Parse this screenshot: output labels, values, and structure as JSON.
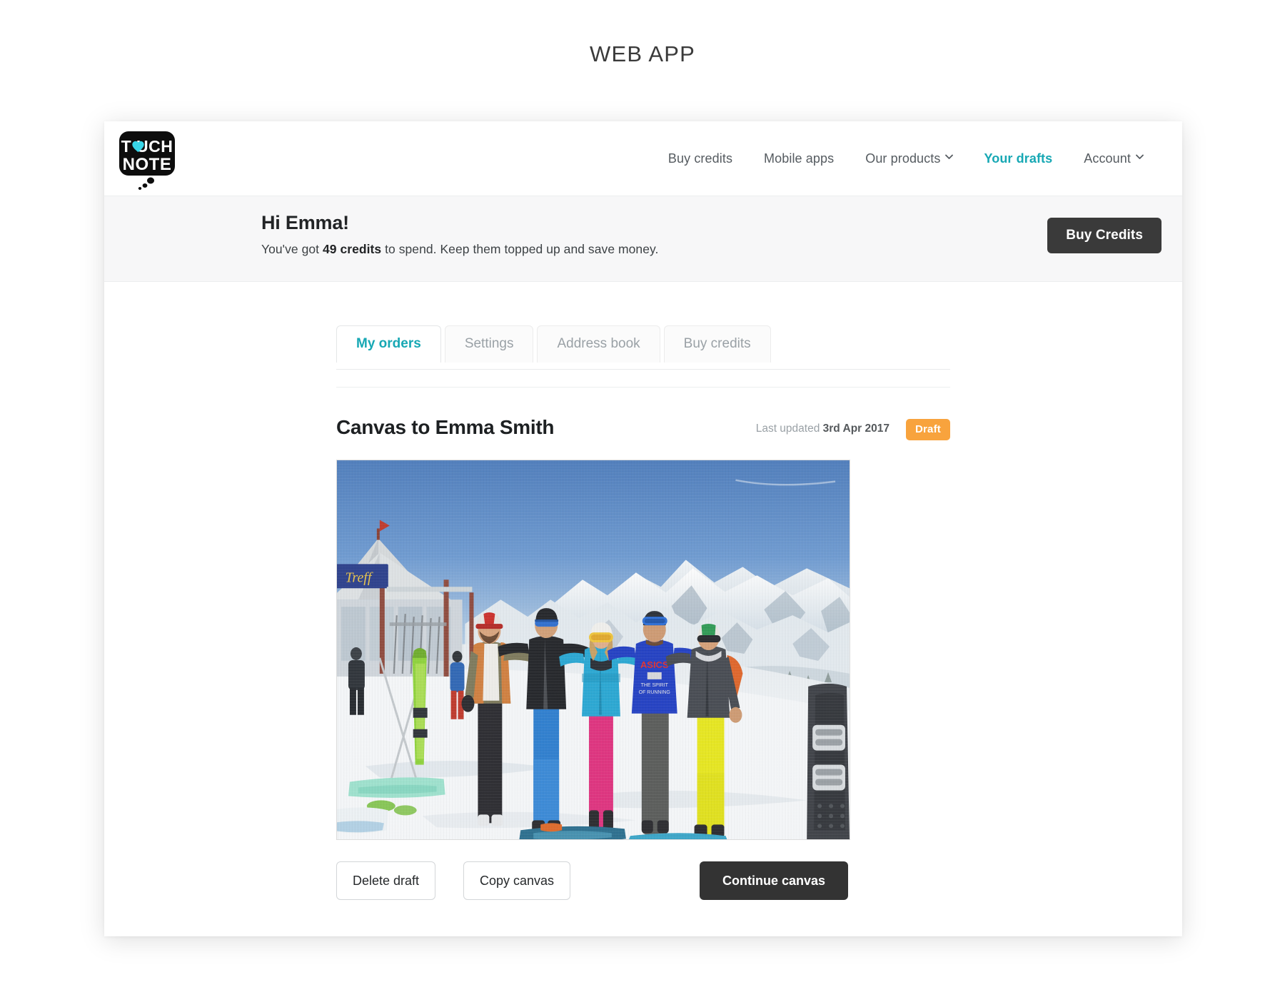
{
  "page": {
    "caption": "WEB APP"
  },
  "header": {
    "logo": {
      "name": "touchnote-logo",
      "line1": "T",
      "heart": "♥",
      "line1b": "UCH",
      "line2": "NOTE"
    },
    "nav": [
      {
        "label": "Buy credits",
        "active": false,
        "caret": false
      },
      {
        "label": "Mobile apps",
        "active": false,
        "caret": false
      },
      {
        "label": "Our products",
        "active": false,
        "caret": true
      },
      {
        "label": "Your drafts",
        "active": true,
        "caret": false
      },
      {
        "label": "Account",
        "active": false,
        "caret": true
      }
    ]
  },
  "greeting": {
    "title": "Hi Emma!",
    "sub_before": "You've got ",
    "sub_bold": "49 credits",
    "sub_after": " to spend. Keep them topped up and save money.",
    "buy_credits_label": "Buy Credits"
  },
  "tabs": [
    {
      "label": "My orders",
      "active": true
    },
    {
      "label": "Settings",
      "active": false
    },
    {
      "label": "Address book",
      "active": false
    },
    {
      "label": "Buy credits",
      "active": false
    }
  ],
  "order": {
    "title": "Canvas to Emma Smith",
    "meta_label": "Last updated ",
    "meta_date": "3rd Apr 2017",
    "status_badge": "Draft",
    "photo": {
      "name": "ski-group-photo",
      "alt": "Five friends standing together on a snowy mountain top at a ski resort, with snow covered peaks and blue sky behind them, skis and snowboards in the snow and a resort hut with a blue sign on the left"
    },
    "actions": {
      "delete_label": "Delete draft",
      "copy_label": "Copy canvas",
      "continue_label": "Continue canvas"
    }
  },
  "colors": {
    "accent_teal": "#17a8b4",
    "badge_orange": "#f8a33d",
    "dark_button": "#3a3a3a",
    "banner_grey": "#f7f7f8",
    "muted_text": "#9aa1a6"
  }
}
